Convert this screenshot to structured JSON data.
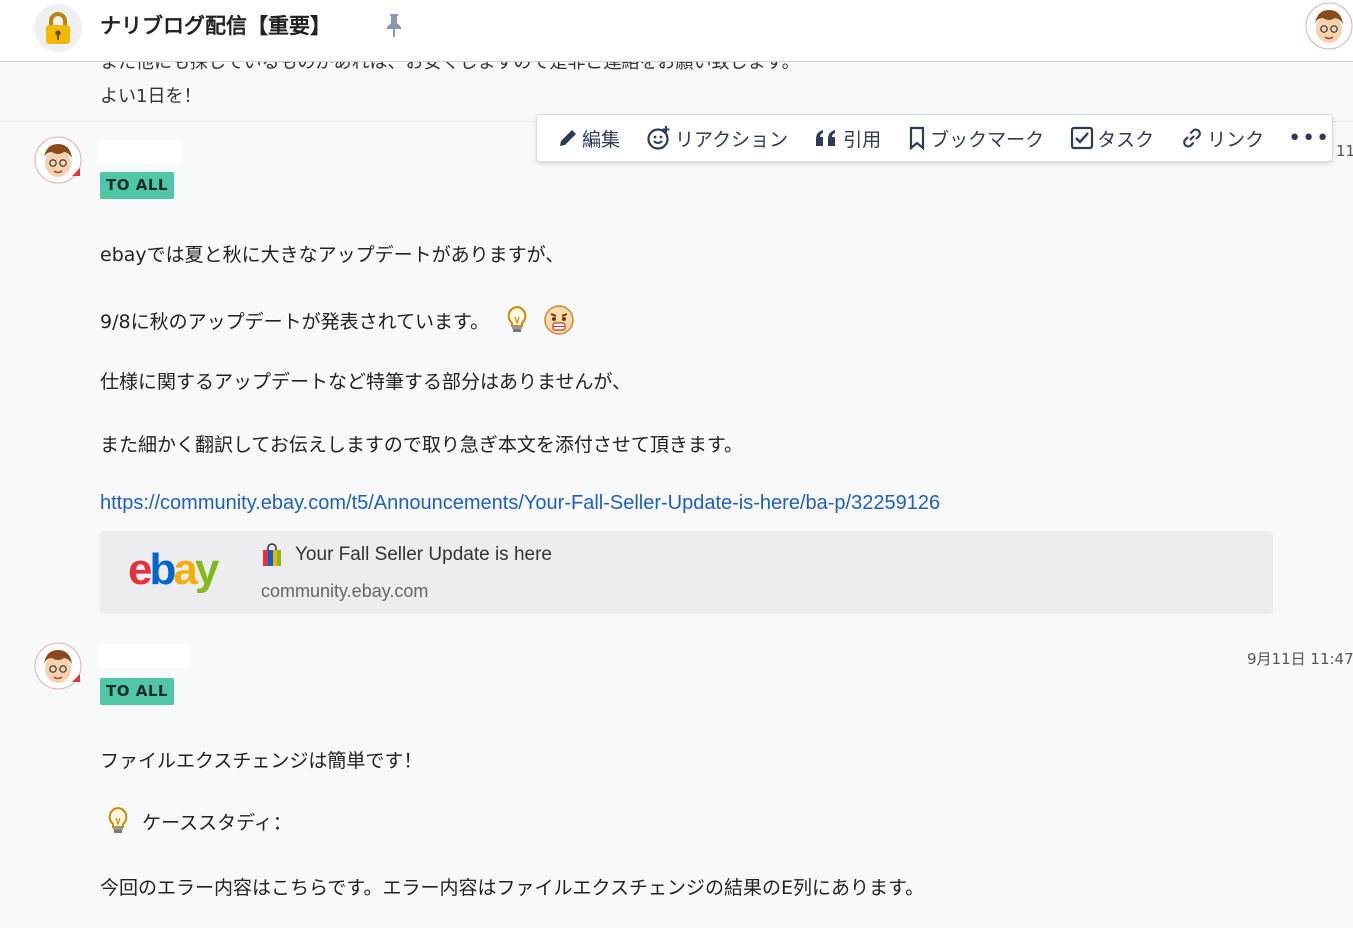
{
  "header": {
    "room_title": "ナリブログ配信【重要】"
  },
  "previous_message": {
    "line1": "また他にも探しているものがあれは、お安くしますので是非ご連絡をお願い致します。",
    "line2": "よい1日を！"
  },
  "toolbar": {
    "edit_label": "編集",
    "reaction_label": "リアクション",
    "quote_label": "引用",
    "bookmark_label": "ブックマーク",
    "task_label": "タスク",
    "link_label": "リンク",
    "more_label": "•••"
  },
  "messages": [
    {
      "badge": "TO ALL",
      "timestamp_partial": "11",
      "lines": [
        "ebayでは夏と秋に大きなアップデートがありますが、",
        "9/8に秋のアップデートが発表されています。",
        "仕様に関するアップデートなど特筆する部分はありませんが、",
        "また細かく翻訳してお伝えしますので取り急ぎ本文を添付させて頂きます。"
      ],
      "url": "https://community.ebay.com/t5/Announcements/Your-Fall-Seller-Update-is-here/ba-p/32259126",
      "preview": {
        "logo_e": "e",
        "logo_b": "b",
        "logo_a": "a",
        "logo_y": "y",
        "title": "Your Fall Seller Update is here",
        "domain": "community.ebay.com"
      }
    },
    {
      "badge": "TO ALL",
      "timestamp": "9月11日 11:47",
      "lines": [
        "ファイルエクスチェンジは簡単です！",
        "ケーススタディ：",
        "今回のエラー内容はこちらです。エラー内容はファイルエクスチェンジの結果のE列にあります。"
      ]
    }
  ],
  "colors": {
    "badge_bg": "#4fc6a6",
    "link": "#1e5fbf",
    "toolbar_icon": "#2d3b57",
    "ebay_red": "#e53238",
    "ebay_blue": "#0064d2",
    "ebay_yellow": "#f5af02",
    "ebay_green": "#86b817"
  }
}
